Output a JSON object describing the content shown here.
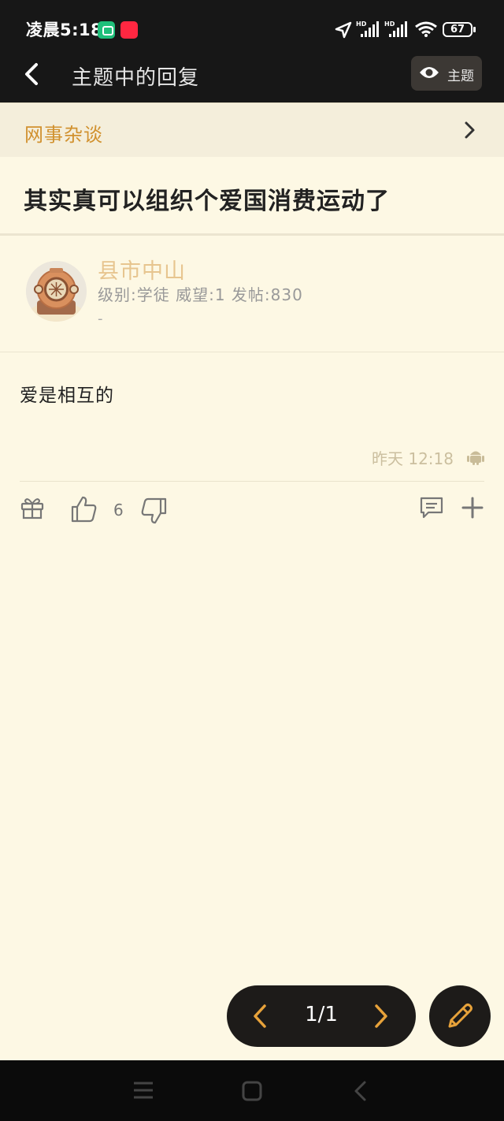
{
  "status_bar": {
    "time": "凌晨5:18",
    "battery": "67"
  },
  "app_bar": {
    "title": "主题中的回复",
    "topic_button_label": "主题"
  },
  "forum": {
    "name": "网事杂谈"
  },
  "thread": {
    "title": "其实真可以组织个爱国消费运动了"
  },
  "post": {
    "author": "县市中山",
    "meta": "级别:学徒 威望:1 发帖:830",
    "signature": "-",
    "content": "爱是相互的",
    "time": "昨天 12:18",
    "like_count": "6"
  },
  "pager": {
    "label": "1/1"
  },
  "colors": {
    "accent": "#d1912f",
    "background": "#fdf8e4",
    "dark_bar": "#171717"
  }
}
